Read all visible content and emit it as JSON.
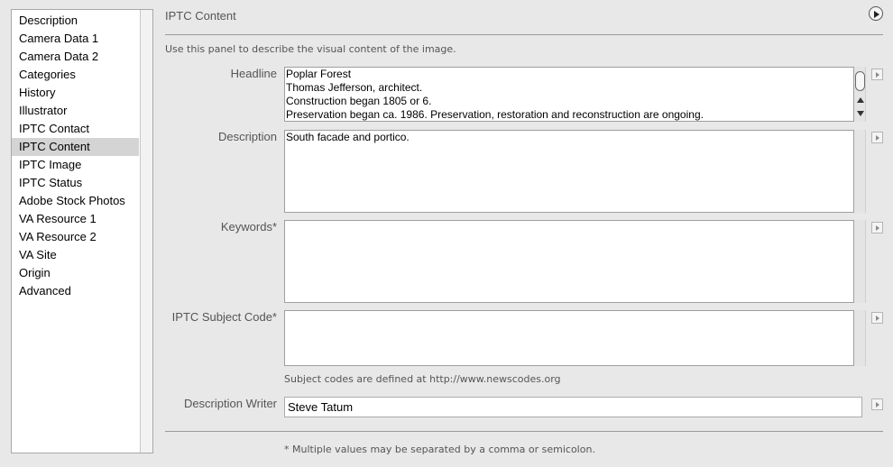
{
  "sidebar": {
    "items": [
      {
        "label": "Description"
      },
      {
        "label": "Camera Data 1"
      },
      {
        "label": "Camera Data 2"
      },
      {
        "label": "Categories"
      },
      {
        "label": "History"
      },
      {
        "label": "Illustrator"
      },
      {
        "label": "IPTC Contact"
      },
      {
        "label": "IPTC Content",
        "selected": true
      },
      {
        "label": "IPTC Image"
      },
      {
        "label": "IPTC Status"
      },
      {
        "label": "Adobe Stock Photos"
      },
      {
        "label": "VA Resource 1"
      },
      {
        "label": "VA Resource 2"
      },
      {
        "label": "VA Site"
      },
      {
        "label": "Origin"
      },
      {
        "label": "Advanced"
      }
    ]
  },
  "panel": {
    "title": "IPTC Content",
    "description": "Use this panel to describe the visual content of the image.",
    "footnote": "* Multiple values may be separated by a comma or semicolon."
  },
  "fields": {
    "headline": {
      "label": "Headline",
      "lines": [
        "Poplar Forest",
        "Thomas Jefferson, architect.",
        "Construction began 1805 or 6.",
        "Preservation began ca. 1986. Preservation, restoration and reconstruction are ongoing."
      ]
    },
    "description": {
      "label": "Description",
      "value": "South facade and portico."
    },
    "keywords": {
      "label": "Keywords*",
      "value": ""
    },
    "subject_code": {
      "label": "IPTC Subject Code*",
      "value": "",
      "hint": "Subject codes are defined at http://www.newscodes.org"
    },
    "description_writer": {
      "label": "Description Writer",
      "value": "Steve Tatum"
    }
  },
  "icons": {
    "panel_menu": "play-circle-icon",
    "field_menu": "triangle-right-icon"
  }
}
